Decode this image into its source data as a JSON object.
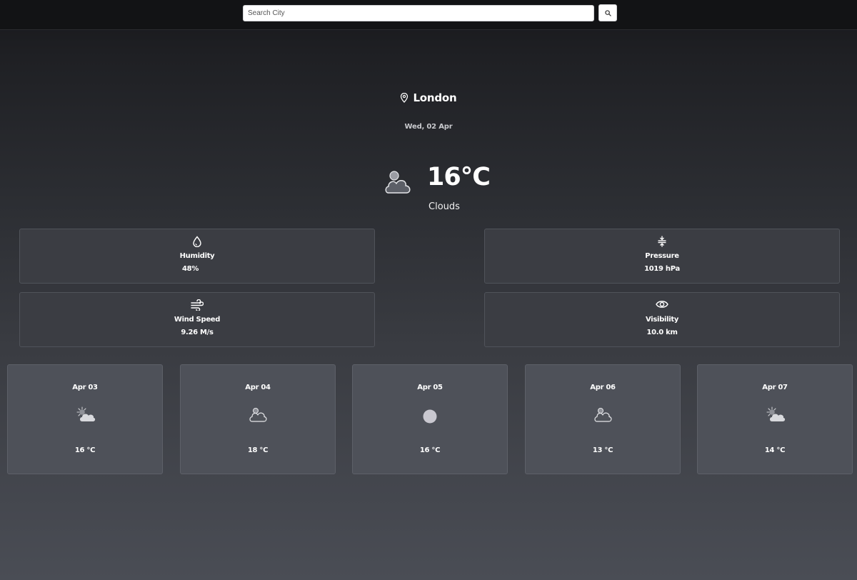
{
  "search": {
    "placeholder": "Search City",
    "icon": "search-icon"
  },
  "location": {
    "city": "London",
    "icon": "map-pin-icon"
  },
  "date": "Wed, 02 Apr",
  "current": {
    "temperature": "16°C",
    "condition": "Clouds",
    "icon": "cloud-icon"
  },
  "stats": {
    "humidity": {
      "label": "Humidity",
      "value": "48%",
      "icon": "droplet-icon"
    },
    "pressure": {
      "label": "Pressure",
      "value": "1019 hPa",
      "icon": "compress-icon"
    },
    "wind": {
      "label": "Wind Speed",
      "value": "9.26 M/s",
      "icon": "wind-icon"
    },
    "visibility": {
      "label": "Visibility",
      "value": "10.0 km",
      "icon": "eye-icon"
    }
  },
  "forecast": [
    {
      "date": "Apr 03",
      "temp": "16 °C",
      "icon": "sun-cloud-icon"
    },
    {
      "date": "Apr 04",
      "temp": "18 °C",
      "icon": "cloud-icon"
    },
    {
      "date": "Apr 05",
      "temp": "16 °C",
      "icon": "moon-icon"
    },
    {
      "date": "Apr 06",
      "temp": "13 °C",
      "icon": "cloud-icon"
    },
    {
      "date": "Apr 07",
      "temp": "14 °C",
      "icon": "sun-cloud-icon"
    }
  ],
  "colors": {
    "background_top": "#17181b",
    "background_bottom": "#4a4d55",
    "stat_card": "#3b3d43",
    "forecast_card": "#4e5159",
    "text": "#ffffff",
    "muted_text": "#c8c9cd"
  }
}
